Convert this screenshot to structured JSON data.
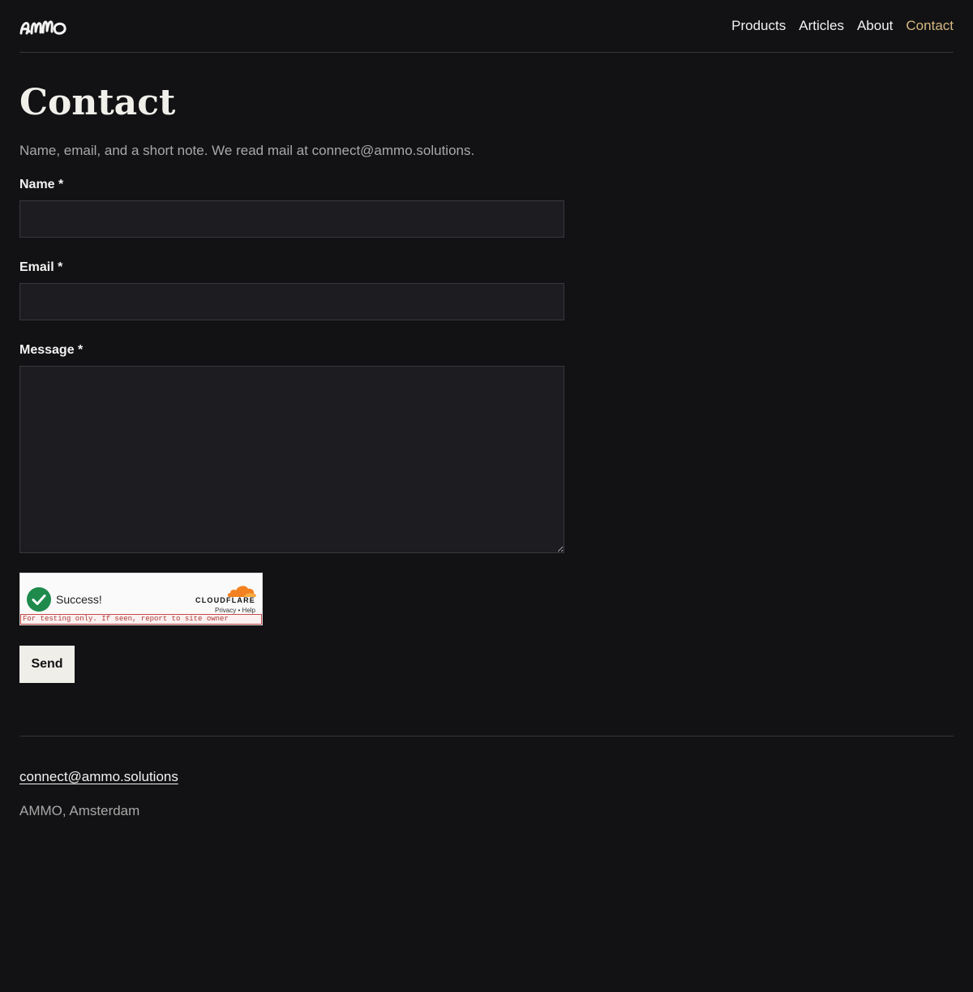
{
  "header": {
    "logo_text": "ammo",
    "nav": [
      {
        "label": "Products"
      },
      {
        "label": "Articles"
      },
      {
        "label": "About"
      },
      {
        "label": "Contact",
        "active": true
      }
    ]
  },
  "main": {
    "title": "Contact",
    "intro": "Name, email, and a short note. We read mail at connect@ammo.solutions.",
    "form": {
      "name_label": "Name *",
      "name_value": "",
      "email_label": "Email *",
      "email_value": "",
      "message_label": "Message *",
      "message_value": "",
      "submit_label": "Send"
    },
    "turnstile": {
      "status": "Success!",
      "brand": "CLOUDFLARE",
      "privacy_label": "Privacy",
      "separator": "•",
      "help_label": "Help",
      "test_note": "For testing only. If seen, report to site owner"
    }
  },
  "footer": {
    "email": "connect@ammo.solutions",
    "address": "AMMO, Amsterdam"
  },
  "colors": {
    "background": "#121214",
    "accent": "#d5b882",
    "input_bg": "#1c1c21",
    "button_bg": "#efeee8",
    "success_green": "#1e8a4c",
    "cloudflare_orange": "#f48120"
  }
}
